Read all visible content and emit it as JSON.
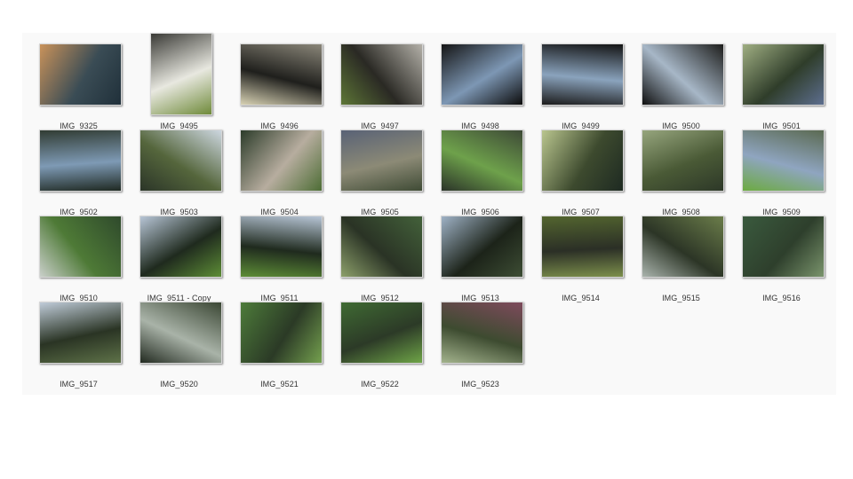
{
  "files": [
    {
      "name": "IMG_9325",
      "orientation": "landscape",
      "colors": [
        "#c9925a",
        "#3a4c55",
        "#20303a"
      ]
    },
    {
      "name": "IMG_9495",
      "orientation": "portrait",
      "colors": [
        "#3a3a36",
        "#e8e8e0",
        "#6f8a3a"
      ]
    },
    {
      "name": "IMG_9496",
      "orientation": "landscape",
      "colors": [
        "#8a8679",
        "#1f1f1c",
        "#d8d2b4"
      ]
    },
    {
      "name": "IMG_9497",
      "orientation": "landscape",
      "colors": [
        "#b3b0a8",
        "#2a2924",
        "#5d7636"
      ]
    },
    {
      "name": "IMG_9498",
      "orientation": "landscape",
      "colors": [
        "#151515",
        "#7d97b4",
        "#0c0c0c"
      ]
    },
    {
      "name": "IMG_9499",
      "orientation": "landscape",
      "colors": [
        "#141414",
        "#8aa3bd",
        "#1c1c1c"
      ]
    },
    {
      "name": "IMG_9500",
      "orientation": "landscape",
      "colors": [
        "#1e1e1c",
        "#a7b7c7",
        "#0f0f0f"
      ]
    },
    {
      "name": "IMG_9501",
      "orientation": "landscape",
      "colors": [
        "#9fae82",
        "#2f3d2a",
        "#5d6e8f"
      ]
    },
    {
      "name": "IMG_9502",
      "orientation": "landscape",
      "colors": [
        "#313c33",
        "#7e9ab5",
        "#1f2922"
      ]
    },
    {
      "name": "IMG_9503",
      "orientation": "landscape",
      "colors": [
        "#cdd7e0",
        "#55663c",
        "#2b3528"
      ]
    },
    {
      "name": "IMG_9504",
      "orientation": "landscape",
      "colors": [
        "#2c3c2a",
        "#b7ad9f",
        "#4d6d35"
      ]
    },
    {
      "name": "IMG_9505",
      "orientation": "landscape",
      "colors": [
        "#596276",
        "#8c8a76",
        "#3f4b35"
      ]
    },
    {
      "name": "IMG_9506",
      "orientation": "landscape",
      "colors": [
        "#3e4a37",
        "#6ea14b",
        "#2b3329"
      ]
    },
    {
      "name": "IMG_9507",
      "orientation": "landscape",
      "colors": [
        "#b9c58e",
        "#3d4a2e",
        "#1e2a22"
      ]
    },
    {
      "name": "IMG_9508",
      "orientation": "landscape",
      "colors": [
        "#96a57d",
        "#4a5a36",
        "#2d3828"
      ]
    },
    {
      "name": "IMG_9509",
      "orientation": "landscape",
      "colors": [
        "#5b6a52",
        "#8fa5c0",
        "#6caa40"
      ]
    },
    {
      "name": "IMG_9510",
      "orientation": "landscape",
      "colors": [
        "#2f4a2c",
        "#4e7a36",
        "#c9cfc9"
      ]
    },
    {
      "name": "IMG_9511 - Copy",
      "orientation": "landscape",
      "colors": [
        "#b7c5d6",
        "#1f2a1e",
        "#5d8d36"
      ]
    },
    {
      "name": "IMG_9511",
      "orientation": "landscape",
      "colors": [
        "#b7c5d6",
        "#1f2a1e",
        "#5d8d36"
      ]
    },
    {
      "name": "IMG_9512",
      "orientation": "landscape",
      "colors": [
        "#43613a",
        "#2a3325",
        "#8da06b"
      ]
    },
    {
      "name": "IMG_9513",
      "orientation": "landscape",
      "colors": [
        "#9fb2c6",
        "#1c2319",
        "#3d4d34"
      ]
    },
    {
      "name": "IMG_9514",
      "orientation": "landscape",
      "colors": [
        "#53652f",
        "#2b2f26",
        "#7c8f4b"
      ]
    },
    {
      "name": "IMG_9515",
      "orientation": "landscape",
      "colors": [
        "#6b7d4a",
        "#2c3526",
        "#a9b3ac"
      ]
    },
    {
      "name": "IMG_9516",
      "orientation": "landscape",
      "colors": [
        "#3a5a3e",
        "#2e3f2c",
        "#7a946c"
      ]
    },
    {
      "name": "IMG_9517",
      "orientation": "landscape",
      "colors": [
        "#bfcbd8",
        "#2a3424",
        "#5e7248"
      ]
    },
    {
      "name": "IMG_9520",
      "orientation": "landscape",
      "colors": [
        "#3b4734",
        "#a9b3a8",
        "#222a20"
      ]
    },
    {
      "name": "IMG_9521",
      "orientation": "landscape",
      "colors": [
        "#4d7b3a",
        "#2b3a26",
        "#74a04e"
      ]
    },
    {
      "name": "IMG_9522",
      "orientation": "landscape",
      "colors": [
        "#3f6a33",
        "#2c3a27",
        "#6ea447"
      ]
    },
    {
      "name": "IMG_9523",
      "orientation": "landscape",
      "colors": [
        "#7e4a5c",
        "#3d4b30",
        "#a3b38d"
      ]
    }
  ]
}
